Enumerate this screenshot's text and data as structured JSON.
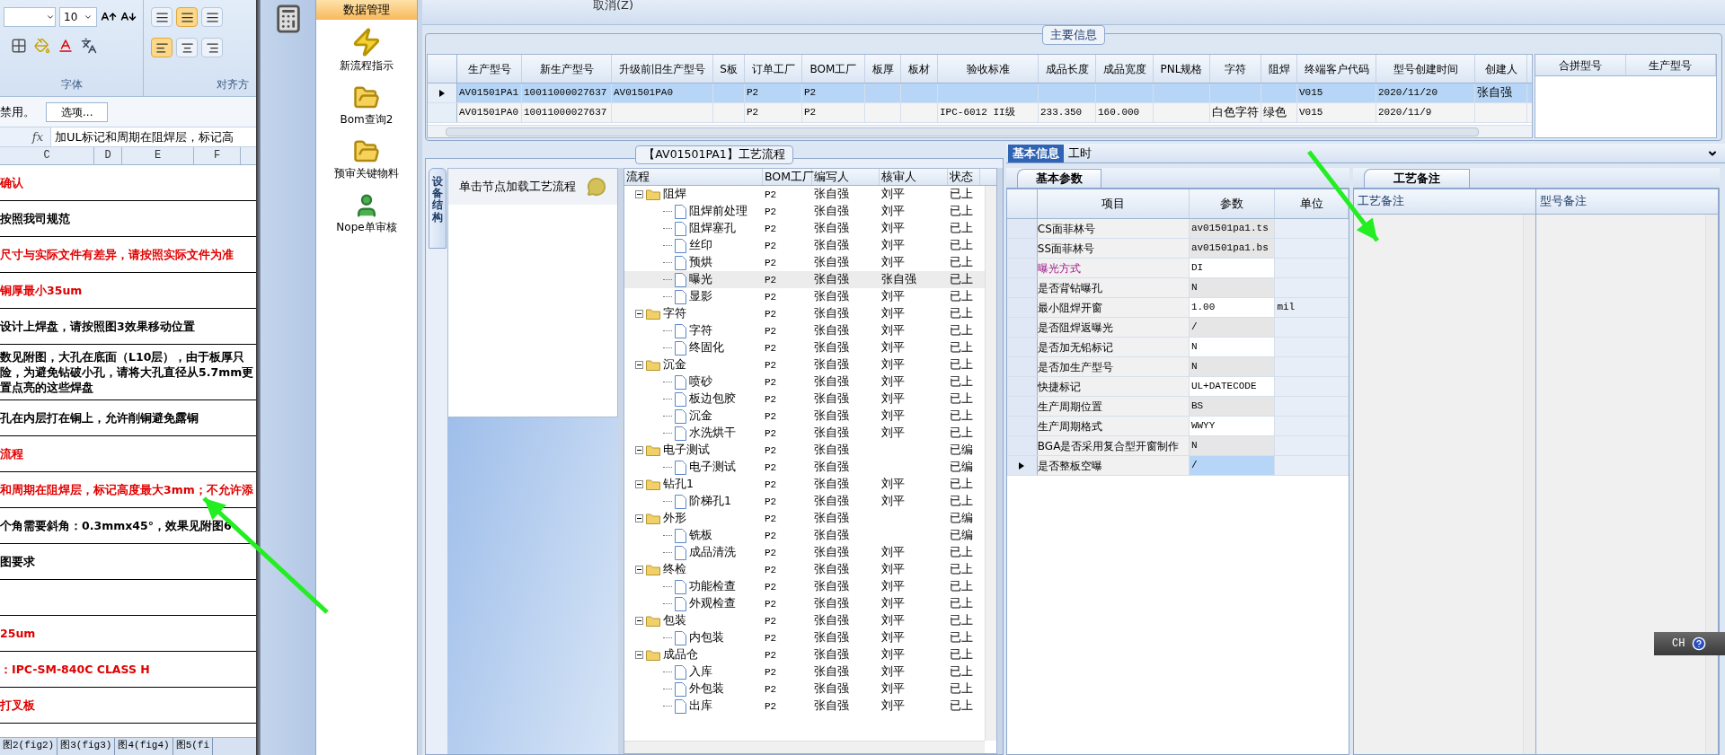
{
  "excel": {
    "font_size": "10",
    "vertical_align": [
      {
        "selected": false
      },
      {
        "selected": true
      },
      {
        "selected": false
      }
    ],
    "horizontal_align": [
      {
        "selected": true
      },
      {
        "selected": false
      },
      {
        "selected": false
      }
    ],
    "group_labels": [
      "字体",
      "对齐方"
    ],
    "message": "禁用。",
    "options_button": "选项...",
    "formula_label": "fx",
    "formula": "加UL标记和周期在阻焊层，标记高",
    "columns": [
      "C",
      "D",
      "E",
      "F"
    ],
    "rows": [
      {
        "lines": [
          "确认"
        ],
        "red": true
      },
      {
        "lines": [
          "按照我司规范"
        ],
        "red": false
      },
      {
        "lines": [
          "尺寸与实际文件有差异，请按照实际文件为准"
        ],
        "red": true
      },
      {
        "lines": [
          "铜厚最小35um"
        ],
        "red": true
      },
      {
        "lines": [
          "设计上焊盘，请按照图3效果移动位置"
        ],
        "red": false
      },
      {
        "lines": [
          "数见附图，大孔在底面（L10层），由于板厚只",
          "险，为避免钻破小孔，请将大孔直径从5.7mm更",
          "置点亮的这些焊盘"
        ],
        "red": false
      },
      {
        "lines": [
          "孔在内层打在铜上，允许削铜避免露铜"
        ],
        "red": false
      },
      {
        "lines": [
          "流程"
        ],
        "red": true
      },
      {
        "lines": [
          "和周期在阻焊层，标记高度最大3mm；不允许添"
        ],
        "red": true
      },
      {
        "lines": [
          "个角需要斜角：0.3mmx45°，效果见附图6"
        ],
        "red": false
      },
      {
        "lines": [
          "图要求"
        ],
        "red": false
      },
      {
        "lines": []
      },
      {
        "lines": [
          "25um"
        ],
        "red": true
      },
      {
        "lines": [
          "：IPC-SM-840C CLASS H"
        ],
        "red": true
      },
      {
        "lines": [
          "打叉板"
        ],
        "red": true
      }
    ],
    "sheet_tabs": [
      "图2(fig2)",
      "图3(fig3)",
      "图4(fig4)",
      "图5(fi"
    ]
  },
  "toolbar": {
    "cancel": "取消(Z)"
  },
  "nav": {
    "title": "数据管理",
    "items": [
      {
        "label": "新流程指示",
        "kind": "bolt"
      },
      {
        "label": "Bom查询2",
        "kind": "folder"
      },
      {
        "label": "预审关键物料",
        "kind": "folder"
      },
      {
        "label": "Nope单审核",
        "kind": "user"
      }
    ]
  },
  "main_info": {
    "title": "主要信息",
    "columns": [
      "生产型号",
      "新生产型号",
      "升级前旧生产型号",
      "S板",
      "订单工厂",
      "BOM工厂",
      "板厚",
      "板材",
      "验收标准",
      "成品长度",
      "成品宽度",
      "PNL规格",
      "字符",
      "阻焊",
      "终端客户代码",
      "型号创建时间",
      "创建人"
    ],
    "rows": [
      {
        "selected": true,
        "cells": [
          "AV01501PA1",
          "10011000027637",
          "AV01501PA0",
          null,
          "P2",
          "P2",
          null,
          null,
          null,
          null,
          null,
          null,
          null,
          null,
          "V015",
          "2020/11/20",
          "张自强"
        ]
      },
      {
        "selected": false,
        "cells": [
          "AV01501PA0",
          "10011000027637",
          null,
          null,
          "P2",
          "P2",
          null,
          null,
          "IPC-6012 II级",
          "233.350",
          "160.000",
          null,
          "白色字符",
          "绿色",
          "V015",
          "2020/11/9",
          null
        ]
      }
    ],
    "merge_columns": [
      "合拼型号",
      "生产型号"
    ]
  },
  "process": {
    "title": "【AV01501PA1】工艺流程",
    "side_tab": "设备结构",
    "hint": "单击节点加载工艺流程",
    "columns": [
      "流程",
      "BOM工厂",
      "编写人",
      "核审人",
      "状态"
    ],
    "tree": [
      {
        "name": "阻焊",
        "bom": "P2",
        "writer": "张自强",
        "reviewer": "刘平",
        "status": "已上",
        "expanded": true,
        "selected": false,
        "children": [
          {
            "name": "阻焊前处理",
            "bom": "P2",
            "writer": "张自强",
            "reviewer": "刘平",
            "status": "已上",
            "selected": false
          },
          {
            "name": "阻焊塞孔",
            "bom": "P2",
            "writer": "张自强",
            "reviewer": "刘平",
            "status": "已上",
            "selected": false
          },
          {
            "name": "丝印",
            "bom": "P2",
            "writer": "张自强",
            "reviewer": "刘平",
            "status": "已上",
            "selected": false
          },
          {
            "name": "预烘",
            "bom": "P2",
            "writer": "张自强",
            "reviewer": "刘平",
            "status": "已上",
            "selected": false
          },
          {
            "name": "曝光",
            "bom": "P2",
            "writer": "张自强",
            "reviewer": "张自强",
            "status": "已上",
            "selected": true
          },
          {
            "name": "显影",
            "bom": "P2",
            "writer": "张自强",
            "reviewer": "刘平",
            "status": "已上",
            "selected": false
          }
        ]
      },
      {
        "name": "字符",
        "bom": "P2",
        "writer": "张自强",
        "reviewer": "刘平",
        "status": "已上",
        "expanded": true,
        "selected": false,
        "children": [
          {
            "name": "字符",
            "bom": "P2",
            "writer": "张自强",
            "reviewer": "刘平",
            "status": "已上",
            "selected": false
          },
          {
            "name": "终固化",
            "bom": "P2",
            "writer": "张自强",
            "reviewer": "刘平",
            "status": "已上",
            "selected": false
          }
        ]
      },
      {
        "name": "沉金",
        "bom": "P2",
        "writer": "张自强",
        "reviewer": "刘平",
        "status": "已上",
        "expanded": true,
        "selected": false,
        "children": [
          {
            "name": "喷砂",
            "bom": "P2",
            "writer": "张自强",
            "reviewer": "刘平",
            "status": "已上",
            "selected": false
          },
          {
            "name": "板边包胶",
            "bom": "P2",
            "writer": "张自强",
            "reviewer": "刘平",
            "status": "已上",
            "selected": false
          },
          {
            "name": "沉金",
            "bom": "P2",
            "writer": "张自强",
            "reviewer": "刘平",
            "status": "已上",
            "selected": false
          },
          {
            "name": "水洗烘干",
            "bom": "P2",
            "writer": "张自强",
            "reviewer": "刘平",
            "status": "已上",
            "selected": false
          }
        ]
      },
      {
        "name": "电子测试",
        "bom": "P2",
        "writer": "张自强",
        "status": "已编",
        "expanded": true,
        "selected": false,
        "children": [
          {
            "name": "电子测试",
            "bom": "P2",
            "writer": "张自强",
            "status": "已编",
            "selected": false
          }
        ]
      },
      {
        "name": "钻孔1",
        "bom": "P2",
        "writer": "张自强",
        "reviewer": "刘平",
        "status": "已上",
        "expanded": true,
        "selected": false,
        "children": [
          {
            "name": "阶梯孔1",
            "bom": "P2",
            "writer": "张自强",
            "reviewer": "刘平",
            "status": "已上",
            "selected": false
          }
        ]
      },
      {
        "name": "外形",
        "bom": "P2",
        "writer": "张自强",
        "status": "已编",
        "expanded": true,
        "selected": false,
        "children": [
          {
            "name": "铣板",
            "bom": "P2",
            "writer": "张自强",
            "status": "已编",
            "selected": false
          },
          {
            "name": "成品清洗",
            "bom": "P2",
            "writer": "张自强",
            "reviewer": "刘平",
            "status": "已上",
            "selected": false
          }
        ]
      },
      {
        "name": "终检",
        "bom": "P2",
        "writer": "张自强",
        "reviewer": "刘平",
        "status": "已上",
        "expanded": true,
        "selected": false,
        "children": [
          {
            "name": "功能检查",
            "bom": "P2",
            "writer": "张自强",
            "reviewer": "刘平",
            "status": "已上",
            "selected": false
          },
          {
            "name": "外观检查",
            "bom": "P2",
            "writer": "张自强",
            "reviewer": "刘平",
            "status": "已上",
            "selected": false
          }
        ]
      },
      {
        "name": "包装",
        "bom": "P2",
        "writer": "张自强",
        "reviewer": "刘平",
        "status": "已上",
        "expanded": true,
        "selected": false,
        "children": [
          {
            "name": "内包装",
            "bom": "P2",
            "writer": "张自强",
            "reviewer": "刘平",
            "status": "已上",
            "selected": false
          }
        ]
      },
      {
        "name": "成品仓",
        "bom": "P2",
        "writer": "张自强",
        "reviewer": "刘平",
        "status": "已上",
        "expanded": true,
        "selected": false,
        "children": [
          {
            "name": "入库",
            "bom": "P2",
            "writer": "张自强",
            "reviewer": "刘平",
            "status": "已上",
            "selected": false
          },
          {
            "name": "外包装",
            "bom": "P2",
            "writer": "张自强",
            "reviewer": "刘平",
            "status": "已上",
            "selected": false
          },
          {
            "name": "出库",
            "bom": "P2",
            "writer": "张自强",
            "reviewer": "刘平",
            "status": "已上",
            "selected": false
          }
        ]
      }
    ]
  },
  "details": {
    "tabs": [
      {
        "label": "基本信息",
        "selected": true
      },
      {
        "label": "工时",
        "selected": false
      }
    ],
    "sub_tab": "基本参数",
    "columns": [
      "项目",
      "参数",
      "单位"
    ],
    "rows": [
      {
        "item": "CS面菲林号",
        "value": "av01501pa1.ts",
        "editable": false,
        "flagged": false,
        "selected": false
      },
      {
        "item": "SS面菲林号",
        "value": "av01501pa1.bs",
        "editable": false,
        "flagged": false,
        "selected": false
      },
      {
        "item": "曝光方式",
        "value": "DI",
        "editable": true,
        "flagged": true,
        "selected": false
      },
      {
        "item": "是否背钻曝孔",
        "value": "N",
        "editable": false,
        "flagged": false,
        "selected": false
      },
      {
        "item": "最小阻焊开窗",
        "value": "1.00",
        "unit": "mil",
        "editable": true,
        "flagged": false,
        "selected": false
      },
      {
        "item": "是否阻焊返曝光",
        "value": "/",
        "editable": false,
        "flagged": false,
        "selected": false
      },
      {
        "item": "是否加无铅标记",
        "value": "N",
        "editable": true,
        "flagged": false,
        "selected": false
      },
      {
        "item": "是否加生产型号",
        "value": "N",
        "editable": false,
        "flagged": false,
        "selected": false
      },
      {
        "item": "快捷标记",
        "value": "UL+DATECODE",
        "editable": true,
        "flagged": false,
        "selected": false
      },
      {
        "item": "生产周期位置",
        "value": "BS",
        "editable": false,
        "flagged": false,
        "selected": false
      },
      {
        "item": "生产周期格式",
        "value": "WWYY",
        "editable": true,
        "flagged": false,
        "selected": false
      },
      {
        "item": "BGA是否采用复合型开窗制作",
        "value": "N",
        "editable": false,
        "flagged": false,
        "selected": false
      },
      {
        "item": "是否整板空曝",
        "value": "/",
        "flagged": false,
        "selected": true
      }
    ],
    "notes_tab": "工艺备注",
    "notes_columns": [
      "工艺备注",
      "型号备注"
    ]
  },
  "language_bar": {
    "label": "CH"
  }
}
